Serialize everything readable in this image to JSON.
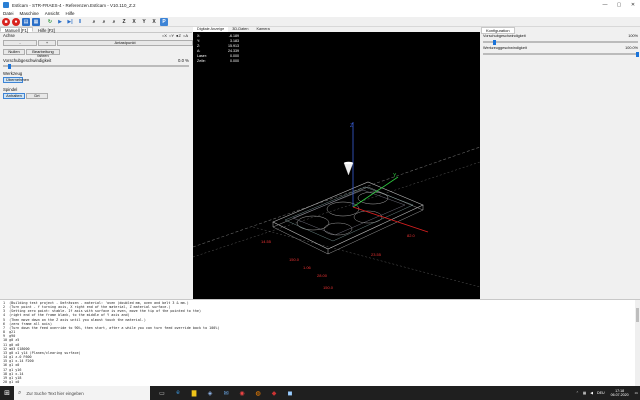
{
  "window": {
    "title": "Estlcam - STR-FRAES-4 - Referenzen.Estlcam - V10.110_Z.2",
    "min": "—",
    "max": "▢",
    "close": "✕"
  },
  "menu": [
    "Datei",
    "Maschine",
    "Ansicht",
    "Hilfe"
  ],
  "toolbar_icons": [
    "stop-icon",
    "record-icon",
    "open-icon",
    "save-icon",
    "refresh-icon",
    "play-icon",
    "step-icon",
    "pause-icon",
    "zoom-in-icon",
    "zoom-out-icon",
    "zoom-fit-icon",
    "view-z-icon",
    "view-x-icon",
    "view-y-icon",
    "view-x2-icon",
    "view-p-icon"
  ],
  "toolbar_glyphs": [
    "■",
    "●",
    "▤",
    "▦",
    "↻",
    "▶",
    "▶|",
    "‖",
    "⌕",
    "⌕",
    "⌕",
    "Z",
    "X",
    "Y",
    "X",
    "P"
  ],
  "left": {
    "tabs": [
      "Manuell [F1]",
      "Hilfe [F2]"
    ],
    "achse_label": "Achse",
    "radio_labels": [
      "X",
      "Y",
      "Z",
      "A"
    ],
    "achse_buttons": [
      "-",
      "+",
      "Antastpunkt"
    ],
    "home_buttons": [
      "Nullen",
      "Bearbeitung fahren"
    ],
    "vorschub_label": "Vorschubgeschwindigkeit",
    "vorschub_value": "0.0 %",
    "vorschub_fraction": 0.02,
    "wzw_label": "Werkzeug",
    "wzw_button": "Übernehmen",
    "spindel_label": "Spindel",
    "spindel_buttons": [
      "Anhalten",
      "Drt"
    ]
  },
  "view": {
    "tabs": [
      "Digitale Anzeige",
      "3D-Daten",
      "Kamera"
    ],
    "coords": [
      {
        "k": "X:",
        "v": "-6.189"
      },
      {
        "k": "Y:",
        "v": "3.183"
      },
      {
        "k": "Z:",
        "v": "15.913"
      },
      {
        "k": "A:",
        "v": "24.339"
      },
      {
        "k": "Laser:",
        "v": "0.000"
      },
      {
        "k": "Zeile:",
        "v": "0.000"
      }
    ],
    "dims": [
      "14.55",
      "150.0",
      "28.00",
      "23.55",
      "82.0",
      "150.0",
      "1.06"
    ]
  },
  "right": {
    "tab": "Konfiguration",
    "rows": [
      {
        "label": "Vorschubgeschwindigkeit",
        "value": "100%",
        "fraction": 0.06
      },
      {
        "label": "Werkzeuggeschwindigkeit",
        "value": "100.0%",
        "fraction": 1.0
      }
    ]
  },
  "console_lines": [
    "1  (Building test project - Umfrässen - material: 'oven (doubled mm, oven and belt 3 & mm.)",
    "2  (Turn point - f turning axis, X right end of the material, Z material surface.)",
    "3  (Setting zero point: stable. If axis with surface is even, move the tip of the pointed to the)",
    "4  (right end of the frame blank, to the middle of Y axis and)",
    "5  (Then move down on the Z axis until you almost touch the material.)",
    "6  (zero frame all axis)",
    "7  (Turn down the feed override to 90%, then start, after a while you can turn feed override back to 100%)",
    "8  g21",
    "9  g90",
    "10 g0 z5",
    "11 g0 x0",
    "12 m03 S18000",
    "13 g0 x1 y14 (Planen/clearing surface)",
    "14 g1 z-0 F600",
    "15 g1 x-14 F200",
    "16 g1 x0",
    "17 g1 y16",
    "18 g1 x-14",
    "19 g1 y18",
    "20 g1 x0"
  ],
  "taskbar": {
    "start": "⊞",
    "search_placeholder": "Zur Suche Text hier eingeben",
    "apps": [
      "task-view-icon",
      "edge-icon",
      "explorer-icon",
      "store-icon",
      "mail-icon",
      "chrome-icon",
      "firefox-icon",
      "estlcam-icon",
      "app-icon"
    ],
    "app_glyphs": [
      "▭",
      "e",
      "▇",
      "◈",
      "✉",
      "◉",
      "◍",
      "◆",
      "◼"
    ],
    "lang": "DEU",
    "time": "17:18",
    "date": "06.07.2020"
  }
}
